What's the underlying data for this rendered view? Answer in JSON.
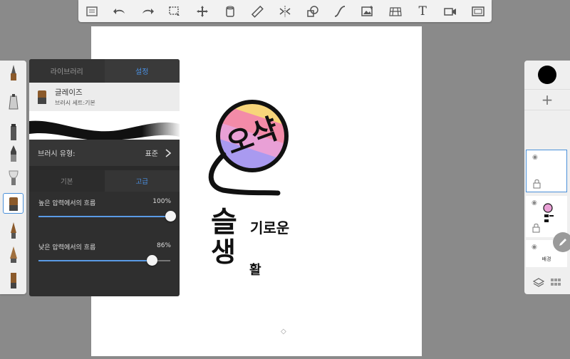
{
  "toolbar": {
    "icons": [
      "list-icon",
      "undo-icon",
      "redo-icon",
      "selection-icon",
      "move-icon",
      "fill-icon",
      "ruler-icon",
      "symmetry-icon",
      "shape-icon",
      "curve-icon",
      "image-icon",
      "perspective-icon",
      "text-icon",
      "video-icon",
      "fullscreen-icon"
    ],
    "text_glyph": "T"
  },
  "brush_panel": {
    "tabs": [
      "라이브러리",
      "설정"
    ],
    "active_tab": "설정",
    "brush_name": "글레이즈",
    "brush_set": "브러시 세트:기본",
    "brush_type_label": "브러시 유형:",
    "brush_type_value": "표준",
    "subtabs": [
      "기본",
      "고급"
    ],
    "active_subtab": "고급",
    "sliders": [
      {
        "label": "높은 압력에서의 흐름",
        "value_text": "100%",
        "value": 1.0
      },
      {
        "label": "낮은 압력에서의 흐름",
        "value_text": "86%",
        "value": 0.86
      }
    ]
  },
  "canvas_art": {
    "bubble_text": "오샥",
    "line1_big": "슬",
    "line1_small": "기로운",
    "line2_big": "생",
    "line2_small": "활"
  },
  "layers": {
    "add_symbol": "+",
    "background_label": "배경",
    "eye_symbol": "◉"
  },
  "colors": {
    "accent": "#4a90e2",
    "current_color": "#000000",
    "panel_bg": "#2f2f2f"
  }
}
